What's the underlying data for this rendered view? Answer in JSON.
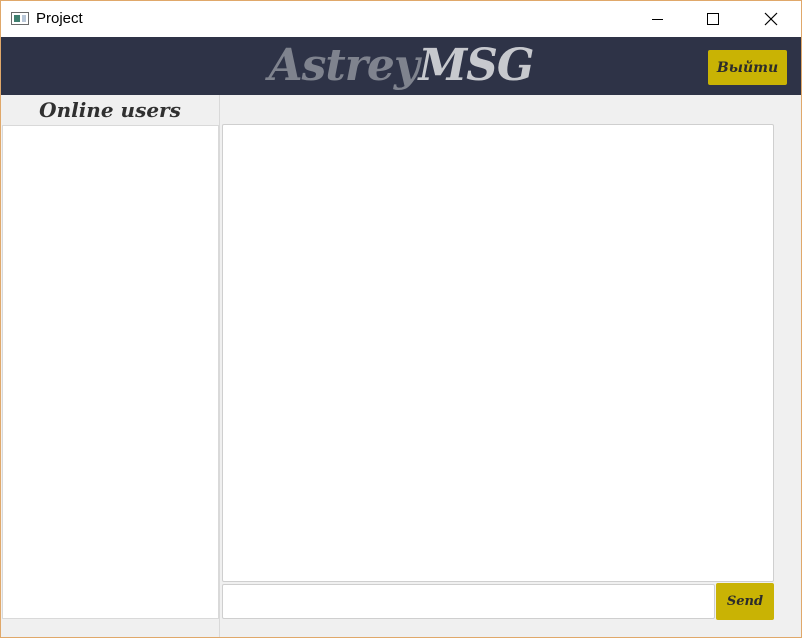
{
  "window": {
    "title": "Project",
    "icon": "app-window-icon",
    "controls": [
      "minimize-icon",
      "maximize-icon",
      "close-icon"
    ]
  },
  "header": {
    "logo_part1": "Astrey",
    "logo_part2": "MSG",
    "exit_label": "Выйти",
    "background": "#2e3347",
    "accent": "#c9b304"
  },
  "sidebar": {
    "title": "Online users",
    "users": []
  },
  "chat": {
    "messages": [],
    "input_value": "",
    "send_label": "Send"
  }
}
